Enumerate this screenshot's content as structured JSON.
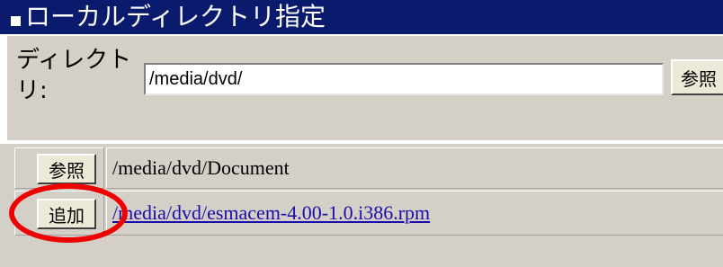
{
  "title": "ローカルディレクトリ指定",
  "directory": {
    "label": "ディレクトリ:",
    "value": "/media/dvd/",
    "browse_label": "参照"
  },
  "rows": [
    {
      "button_label": "参照",
      "path": "/media/dvd/Document",
      "is_link": false
    },
    {
      "button_label": "追加",
      "path": "/media/dvd/esmacem-4.00-1.0.i386.rpm",
      "is_link": true
    }
  ],
  "colors": {
    "title_bar": "#0a1b6e",
    "panel_bg": "#d4d0c8",
    "highlight": "#ee0000",
    "link": "#1a0dab"
  }
}
